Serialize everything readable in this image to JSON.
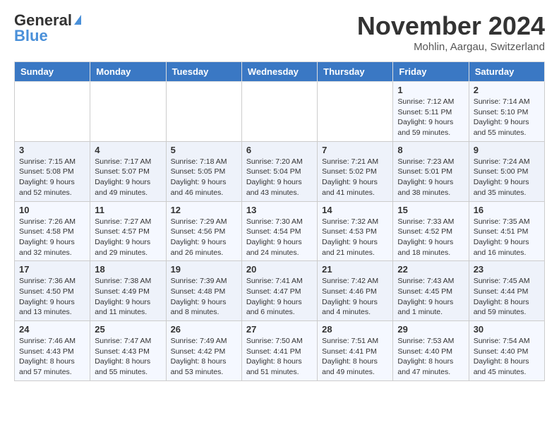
{
  "header": {
    "logo_general": "General",
    "logo_blue": "Blue",
    "month_title": "November 2024",
    "location": "Mohlin, Aargau, Switzerland"
  },
  "weekdays": [
    "Sunday",
    "Monday",
    "Tuesday",
    "Wednesday",
    "Thursday",
    "Friday",
    "Saturday"
  ],
  "weeks": [
    [
      {
        "day": "",
        "detail": ""
      },
      {
        "day": "",
        "detail": ""
      },
      {
        "day": "",
        "detail": ""
      },
      {
        "day": "",
        "detail": ""
      },
      {
        "day": "",
        "detail": ""
      },
      {
        "day": "1",
        "detail": "Sunrise: 7:12 AM\nSunset: 5:11 PM\nDaylight: 9 hours and 59 minutes."
      },
      {
        "day": "2",
        "detail": "Sunrise: 7:14 AM\nSunset: 5:10 PM\nDaylight: 9 hours and 55 minutes."
      }
    ],
    [
      {
        "day": "3",
        "detail": "Sunrise: 7:15 AM\nSunset: 5:08 PM\nDaylight: 9 hours and 52 minutes."
      },
      {
        "day": "4",
        "detail": "Sunrise: 7:17 AM\nSunset: 5:07 PM\nDaylight: 9 hours and 49 minutes."
      },
      {
        "day": "5",
        "detail": "Sunrise: 7:18 AM\nSunset: 5:05 PM\nDaylight: 9 hours and 46 minutes."
      },
      {
        "day": "6",
        "detail": "Sunrise: 7:20 AM\nSunset: 5:04 PM\nDaylight: 9 hours and 43 minutes."
      },
      {
        "day": "7",
        "detail": "Sunrise: 7:21 AM\nSunset: 5:02 PM\nDaylight: 9 hours and 41 minutes."
      },
      {
        "day": "8",
        "detail": "Sunrise: 7:23 AM\nSunset: 5:01 PM\nDaylight: 9 hours and 38 minutes."
      },
      {
        "day": "9",
        "detail": "Sunrise: 7:24 AM\nSunset: 5:00 PM\nDaylight: 9 hours and 35 minutes."
      }
    ],
    [
      {
        "day": "10",
        "detail": "Sunrise: 7:26 AM\nSunset: 4:58 PM\nDaylight: 9 hours and 32 minutes."
      },
      {
        "day": "11",
        "detail": "Sunrise: 7:27 AM\nSunset: 4:57 PM\nDaylight: 9 hours and 29 minutes."
      },
      {
        "day": "12",
        "detail": "Sunrise: 7:29 AM\nSunset: 4:56 PM\nDaylight: 9 hours and 26 minutes."
      },
      {
        "day": "13",
        "detail": "Sunrise: 7:30 AM\nSunset: 4:54 PM\nDaylight: 9 hours and 24 minutes."
      },
      {
        "day": "14",
        "detail": "Sunrise: 7:32 AM\nSunset: 4:53 PM\nDaylight: 9 hours and 21 minutes."
      },
      {
        "day": "15",
        "detail": "Sunrise: 7:33 AM\nSunset: 4:52 PM\nDaylight: 9 hours and 18 minutes."
      },
      {
        "day": "16",
        "detail": "Sunrise: 7:35 AM\nSunset: 4:51 PM\nDaylight: 9 hours and 16 minutes."
      }
    ],
    [
      {
        "day": "17",
        "detail": "Sunrise: 7:36 AM\nSunset: 4:50 PM\nDaylight: 9 hours and 13 minutes."
      },
      {
        "day": "18",
        "detail": "Sunrise: 7:38 AM\nSunset: 4:49 PM\nDaylight: 9 hours and 11 minutes."
      },
      {
        "day": "19",
        "detail": "Sunrise: 7:39 AM\nSunset: 4:48 PM\nDaylight: 9 hours and 8 minutes."
      },
      {
        "day": "20",
        "detail": "Sunrise: 7:41 AM\nSunset: 4:47 PM\nDaylight: 9 hours and 6 minutes."
      },
      {
        "day": "21",
        "detail": "Sunrise: 7:42 AM\nSunset: 4:46 PM\nDaylight: 9 hours and 4 minutes."
      },
      {
        "day": "22",
        "detail": "Sunrise: 7:43 AM\nSunset: 4:45 PM\nDaylight: 9 hours and 1 minute."
      },
      {
        "day": "23",
        "detail": "Sunrise: 7:45 AM\nSunset: 4:44 PM\nDaylight: 8 hours and 59 minutes."
      }
    ],
    [
      {
        "day": "24",
        "detail": "Sunrise: 7:46 AM\nSunset: 4:43 PM\nDaylight: 8 hours and 57 minutes."
      },
      {
        "day": "25",
        "detail": "Sunrise: 7:47 AM\nSunset: 4:43 PM\nDaylight: 8 hours and 55 minutes."
      },
      {
        "day": "26",
        "detail": "Sunrise: 7:49 AM\nSunset: 4:42 PM\nDaylight: 8 hours and 53 minutes."
      },
      {
        "day": "27",
        "detail": "Sunrise: 7:50 AM\nSunset: 4:41 PM\nDaylight: 8 hours and 51 minutes."
      },
      {
        "day": "28",
        "detail": "Sunrise: 7:51 AM\nSunset: 4:41 PM\nDaylight: 8 hours and 49 minutes."
      },
      {
        "day": "29",
        "detail": "Sunrise: 7:53 AM\nSunset: 4:40 PM\nDaylight: 8 hours and 47 minutes."
      },
      {
        "day": "30",
        "detail": "Sunrise: 7:54 AM\nSunset: 4:40 PM\nDaylight: 8 hours and 45 minutes."
      }
    ]
  ]
}
